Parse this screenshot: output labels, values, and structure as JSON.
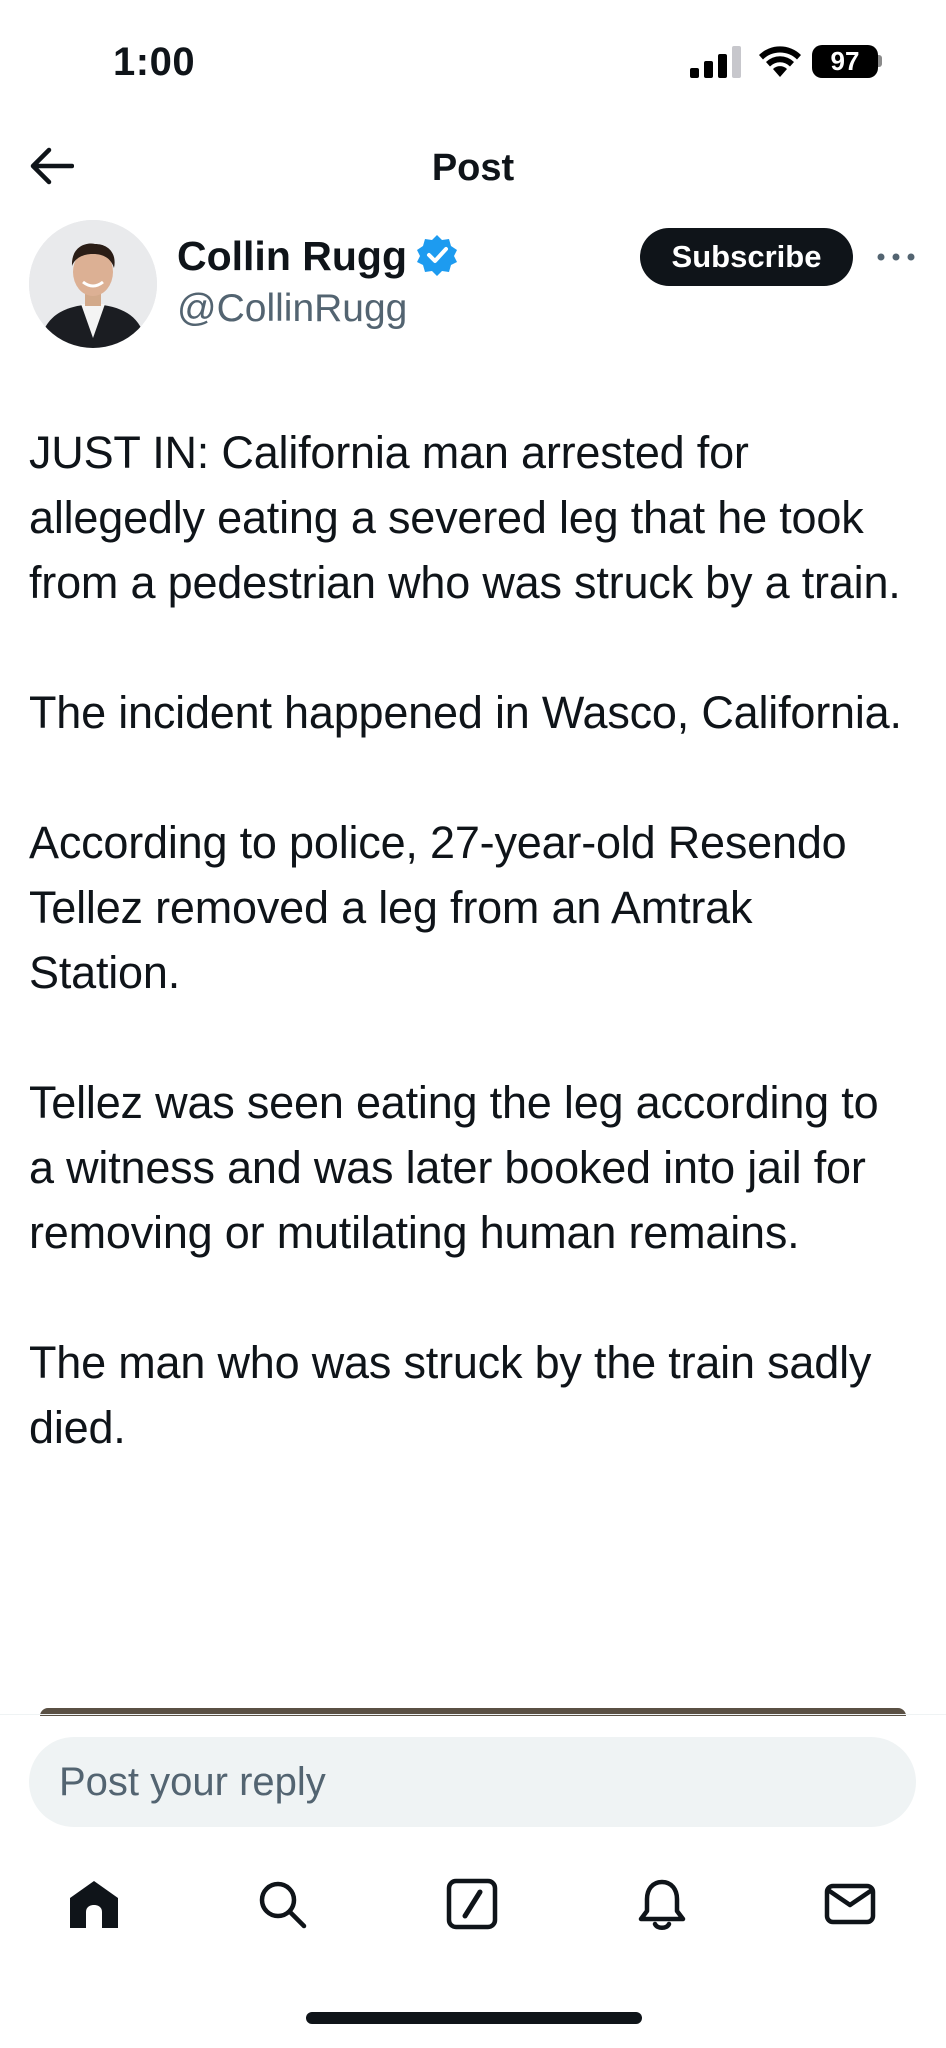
{
  "status_bar": {
    "time": "1:00",
    "battery": "97"
  },
  "header": {
    "title": "Post"
  },
  "author": {
    "name": "Collin Rugg",
    "handle": "@CollinRugg",
    "verified": true,
    "subscribe_label": "Subscribe"
  },
  "post": {
    "paragraphs": [
      "JUST IN: California man arrested for allegedly eating a severed leg that he took from a pedestrian who was struck by a train.",
      "The incident happened in Wasco, California.",
      "According to police, 27-year-old Resendo Tellez removed a leg from an Amtrak Station.",
      "Tellez was seen eating the leg according to a witness and was later booked into jail for removing or mutilating human remains.",
      "The man who was struck by the train sadly died."
    ]
  },
  "reply": {
    "placeholder": "Post your reply"
  },
  "bottom_nav": {
    "icons": [
      "home-icon",
      "search-icon",
      "compose-icon",
      "bell-icon",
      "mail-icon"
    ]
  },
  "colors": {
    "text": "#0f1419",
    "secondary": "#536471",
    "verified": "#1d9bf0",
    "reply_bg": "#eff3f4"
  }
}
